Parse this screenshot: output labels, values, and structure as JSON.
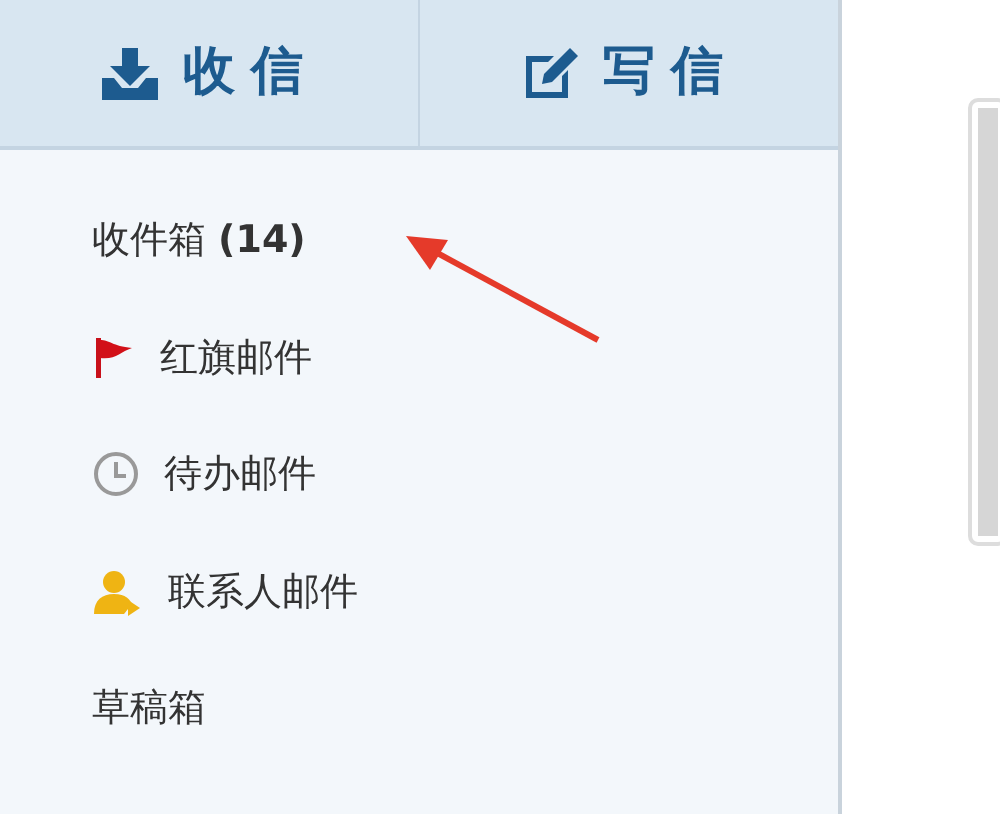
{
  "toolbar": [
    {
      "label": "收信",
      "kind": "receive"
    },
    {
      "label": "写信",
      "kind": "compose"
    }
  ],
  "folders": [
    {
      "label": "收件箱 **(14)**",
      "kind": "plain"
    },
    {
      "label": "红旗邮件",
      "kind": "flagged"
    },
    {
      "label": "待办邮件",
      "kind": "todo"
    },
    {
      "label": "联系人邮件",
      "kind": "contact"
    },
    {
      "label": "草稿箱",
      "kind": "plain"
    }
  ]
}
